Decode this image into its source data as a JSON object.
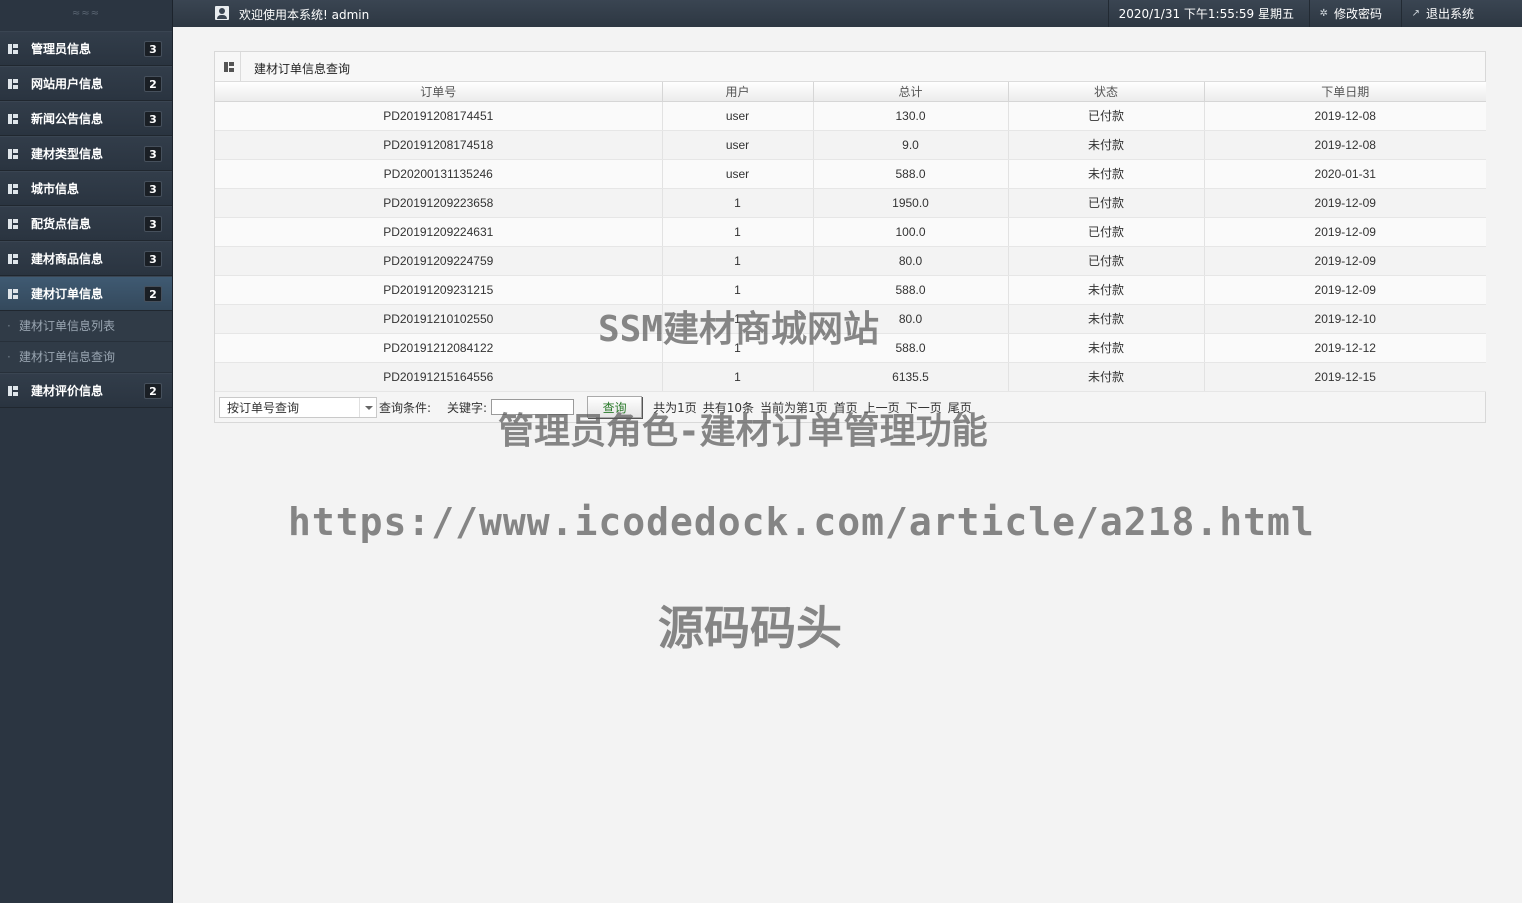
{
  "sidebar": {
    "grip": "≈≈≈",
    "items": [
      {
        "label": "管理员信息",
        "badge": "3"
      },
      {
        "label": "网站用户信息",
        "badge": "2"
      },
      {
        "label": "新闻公告信息",
        "badge": "3"
      },
      {
        "label": "建材类型信息",
        "badge": "3"
      },
      {
        "label": "城市信息",
        "badge": "3"
      },
      {
        "label": "配货点信息",
        "badge": "3"
      },
      {
        "label": "建材商品信息",
        "badge": "3"
      },
      {
        "label": "建材订单信息",
        "badge": "2",
        "active": true
      },
      {
        "label": "建材评价信息",
        "badge": "2"
      }
    ],
    "subitems": [
      "建材订单信息列表",
      "建材订单信息查询"
    ]
  },
  "topbar": {
    "welcome": "欢迎使用本系统! admin",
    "datetime": "2020/1/31 下午1:55:59 星期五",
    "change_password": "修改密码",
    "logout": "退出系统"
  },
  "panel": {
    "title": "建材订单信息查询",
    "columns": [
      "订单号",
      "用户",
      "总计",
      "状态",
      "下单日期"
    ],
    "rows": [
      [
        "PD20191208174451",
        "user",
        "130.0",
        "已付款",
        "2019-12-08"
      ],
      [
        "PD20191208174518",
        "user",
        "9.0",
        "未付款",
        "2019-12-08"
      ],
      [
        "PD20200131135246",
        "user",
        "588.0",
        "未付款",
        "2020-01-31"
      ],
      [
        "PD20191209223658",
        "1",
        "1950.0",
        "已付款",
        "2019-12-09"
      ],
      [
        "PD20191209224631",
        "1",
        "100.0",
        "已付款",
        "2019-12-09"
      ],
      [
        "PD20191209224759",
        "1",
        "80.0",
        "已付款",
        "2019-12-09"
      ],
      [
        "PD20191209231215",
        "1",
        "588.0",
        "未付款",
        "2019-12-09"
      ],
      [
        "PD20191210102550",
        "1",
        "80.0",
        "未付款",
        "2019-12-10"
      ],
      [
        "PD20191212084122",
        "1",
        "588.0",
        "未付款",
        "2019-12-12"
      ],
      [
        "PD20191215164556",
        "1",
        "6135.5",
        "未付款",
        "2019-12-15"
      ]
    ]
  },
  "toolbar": {
    "select_value": "按订单号查询",
    "condition_label": "查询条件:",
    "keyword_label": "关键字:",
    "keyword_value": "",
    "query_button": "查询",
    "total_pages": "共为1页",
    "total_records": "共有10条",
    "current_page": "当前为第1页",
    "first": "首页",
    "prev": "上一页",
    "next": "下一页",
    "last": "尾页"
  },
  "watermark": {
    "line1": "SSM建材商城网站",
    "line2": "管理员角色-建材订单管理功能",
    "line3": "https://www.icodedock.com/article/a218.html",
    "line4": "源码码头"
  }
}
